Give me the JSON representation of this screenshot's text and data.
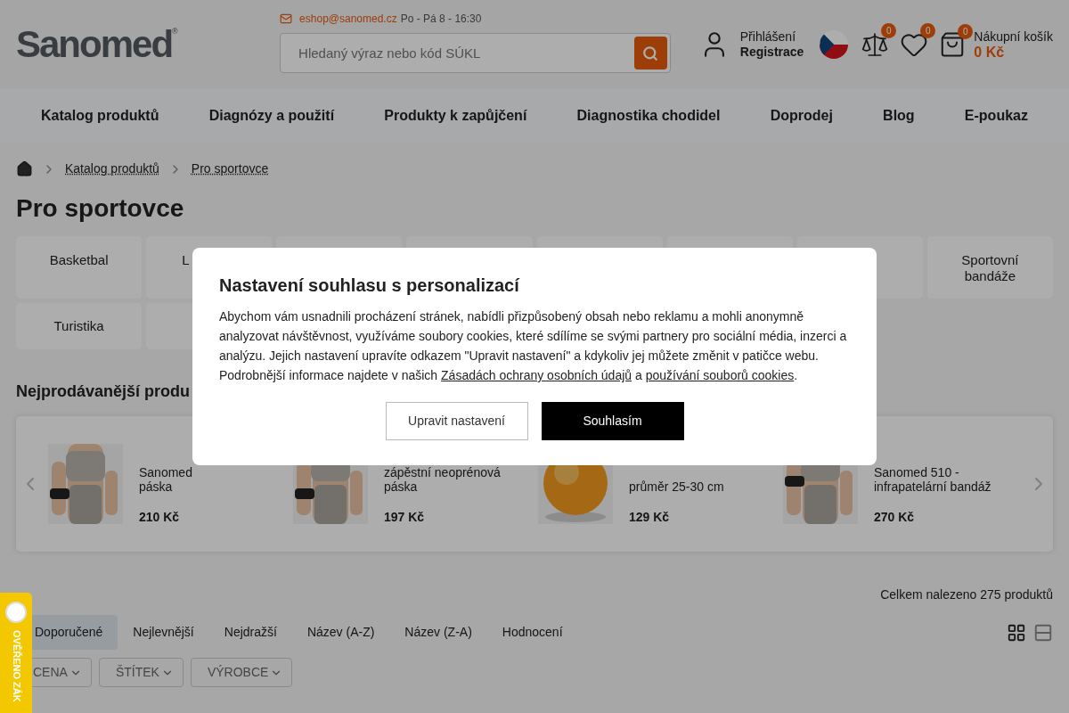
{
  "header": {
    "logo": "Sanomed",
    "logo_mark": "®",
    "email": "eshop@sanomed.cz",
    "hours": "Po - Pá 8 - 16:30",
    "search": {
      "placeholder": "Hledaný výraz nebo kód SÚKL"
    },
    "login": "Přihlášení",
    "register": "Registrace",
    "compare_count": "0",
    "wishlist_count": "0",
    "cart_count": "0",
    "cart_label": "Nákupní košík",
    "cart_total": "0 Kč"
  },
  "nav": [
    "Katalog produktů",
    "Diagnózy a použití",
    "Produkty k zapůjčení",
    "Diagnostika chodidel",
    "Doprodej",
    "Blog",
    "E-poukaz"
  ],
  "breadcrumb": [
    "Katalog produktů",
    "Pro sportovce"
  ],
  "page_title": "Pro sportovce",
  "categories": [
    {
      "kind": "tile",
      "label": "Basketbal"
    },
    {
      "kind": "partial",
      "label": "L"
    },
    {
      "kind": "covered"
    },
    {
      "kind": "covered"
    },
    {
      "kind": "covered"
    },
    {
      "kind": "covered"
    },
    {
      "kind": "covered"
    },
    {
      "kind": "tile",
      "label": "Sportovní bandáže"
    },
    {
      "kind": "tile",
      "label": "Turistika"
    },
    {
      "kind": "covered"
    }
  ],
  "bestsellers": {
    "title": "Nejprodávanější produ",
    "products": [
      {
        "name_lines": [
          "Sanomed",
          "páska"
        ],
        "price": "210 Kč"
      },
      {
        "name_lines": [
          "zápěstní neoprénová",
          "páska"
        ],
        "price": "197 Kč"
      },
      {
        "name_lines": [
          "průměr 25-30 cm"
        ],
        "price": "129 Kč"
      },
      {
        "name_lines": [
          "Sanomed 510 -",
          "infrapatelární bandáž"
        ],
        "price": "270 Kč"
      }
    ]
  },
  "results_count": "Celkem nalezeno 275 produktů",
  "sort_tabs": [
    {
      "label": "Doporučené",
      "selected": true
    },
    {
      "label": "Nejlevnější",
      "selected": false
    },
    {
      "label": "Nejdražší",
      "selected": false
    },
    {
      "label": "Název (A-Z)",
      "selected": false
    },
    {
      "label": "Název (Z-A)",
      "selected": false
    },
    {
      "label": "Hodnocení",
      "selected": false
    }
  ],
  "view_modes": [
    {
      "kind": "grid",
      "selected": true
    },
    {
      "kind": "list",
      "selected": false
    }
  ],
  "filters": [
    "CENA",
    "ŠTÍTEK",
    "VÝROBCE"
  ],
  "badge": {
    "label": "OVĚŘENO ZÁK"
  },
  "consent": {
    "title": "Nastavení souhlasu s personalizací",
    "body": [
      {
        "kind": "text",
        "text": "Abychom vám usnadnili procházení stránek, nabídli přizpůsobený obsah nebo reklamu a mohli anonymně analyzovat návštěvnost, využíváme soubory cookies, které sdílíme se svými partnery pro sociální média, inzerci a analýzu. Jejich nastavení upravíte odkazem \"Upravit nastavení\" a kdykoliv jej můžete změnit v patičce webu. Podrobnější informace najdete v našich "
      },
      {
        "kind": "link",
        "text": "Zásadách ochrany osobních údajů"
      },
      {
        "kind": "text",
        "text": " a "
      },
      {
        "kind": "link",
        "text": "používání souborů cookies"
      },
      {
        "kind": "text",
        "text": "."
      }
    ],
    "buttons": [
      {
        "kind": "secondary",
        "label": "Upravit nastavení"
      },
      {
        "kind": "primary",
        "label": "Souhlasím"
      }
    ]
  }
}
